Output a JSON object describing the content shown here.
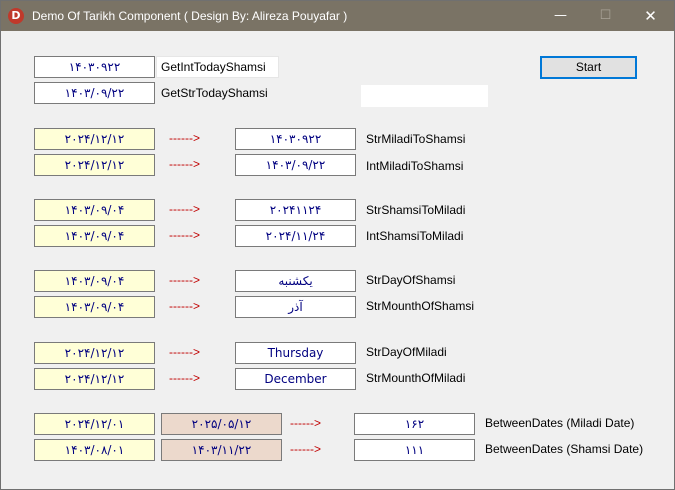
{
  "window": {
    "title": "Demo Of Tarikh Component  ( Design By: Alireza Pouyafar )",
    "icon_letter": "D",
    "controls": {
      "minimize": "—",
      "maximize": "☐",
      "close": "✕"
    }
  },
  "start_button": "Start",
  "arrow_text": "------>",
  "today": {
    "int_value": "۱۴۰۳۰۹۲۲",
    "int_label": "GetIntTodayShamsi",
    "str_value": "۱۴۰۳/۰۹/۲۲",
    "str_label": "GetStrTodayShamsi"
  },
  "rows": [
    {
      "input": "۲۰۲۴/۱۲/۱۲",
      "output": "۱۴۰۳۰۹۲۲",
      "label": "StrMiladiToShamsi"
    },
    {
      "input": "۲۰۲۴/۱۲/۱۲",
      "output": "۱۴۰۳/۰۹/۲۲",
      "label": "IntMiladiToShamsi"
    },
    {
      "input": "۱۴۰۳/۰۹/۰۴",
      "output": "۲۰۲۴۱۱۲۴",
      "label": "StrShamsiToMiladi"
    },
    {
      "input": "۱۴۰۳/۰۹/۰۴",
      "output": "۲۰۲۴/۱۱/۲۴",
      "label": "IntShamsiToMiladi"
    },
    {
      "input": "۱۴۰۳/۰۹/۰۴",
      "output": "یکشنبه",
      "label": "StrDayOfShamsi"
    },
    {
      "input": "۱۴۰۳/۰۹/۰۴",
      "output": "آذر",
      "label": "StrMounthOfShamsi"
    },
    {
      "input": "۲۰۲۴/۱۲/۱۲",
      "output": "Thursday",
      "label": "StrDayOfMiladi"
    },
    {
      "input": "۲۰۲۴/۱۲/۱۲",
      "output": "December",
      "label": "StrMounthOfMiladi"
    }
  ],
  "between": [
    {
      "from": "۲۰۲۴/۱۲/۰۱",
      "to": "۲۰۲۵/۰۵/۱۲",
      "result": "۱۶۲",
      "label": "BetweenDates (Miladi Date)"
    },
    {
      "from": "۱۴۰۳/۰۸/۰۱",
      "to": "۱۴۰۳/۱۱/۲۲",
      "result": "۱۱۱",
      "label": "BetweenDates (Shamsi Date)"
    }
  ]
}
